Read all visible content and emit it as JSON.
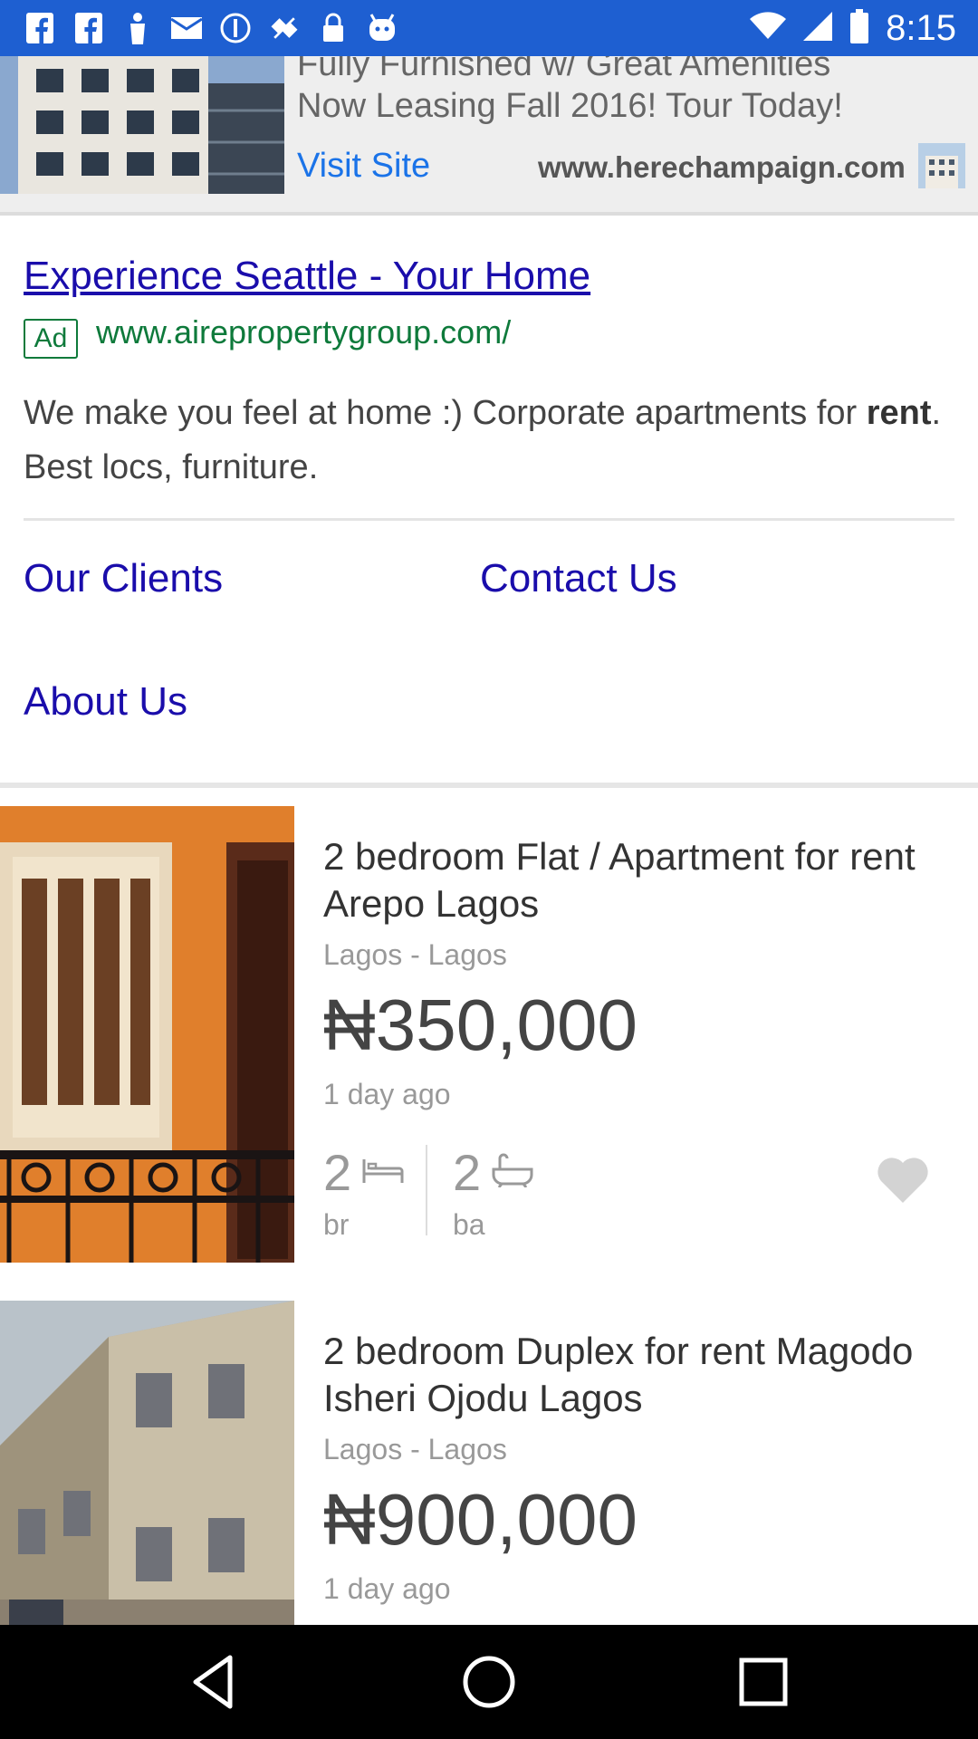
{
  "status_bar": {
    "time": "8:15",
    "icons": [
      "facebook-icon",
      "facebook-icon",
      "person-icon",
      "mail-icon",
      "target-icon",
      "fake-gps-icon",
      "lock-icon",
      "app-icon"
    ],
    "right_icons": [
      "wifi-icon",
      "signal-icon",
      "battery-icon"
    ]
  },
  "banner_ad": {
    "line1": "Fully Furnished w/ Great Amenities",
    "line2": "Now Leasing Fall 2016! Tour Today!",
    "visit_label": "Visit Site",
    "url": "www.herechampaign.com"
  },
  "text_ad": {
    "title": "Experience Seattle - Your Home",
    "badge": "Ad",
    "url": "www.airepropertygroup.com/",
    "description_before": "We make you feel at home :) Corporate apartments for ",
    "description_bold": "rent",
    "description_after": ". Best locs, furniture.",
    "links": [
      "Our Clients",
      "Contact Us",
      "About Us"
    ]
  },
  "listings": [
    {
      "title": "2 bedroom Flat / Apartment for rent Arepo Lagos",
      "location": "Lagos - Lagos",
      "price": "₦350,000",
      "age": "1 day ago",
      "bedrooms": "2",
      "bedrooms_unit": "br",
      "bathrooms": "2",
      "bathrooms_unit": "ba"
    },
    {
      "title": "2 bedroom Duplex for rent Magodo Isheri Ojodu Lagos",
      "location": "Lagos - Lagos",
      "price": "₦900,000",
      "age": "1 day ago"
    }
  ],
  "nav_bar": {
    "buttons": [
      "back-icon",
      "home-icon",
      "recents-icon"
    ]
  },
  "colors": {
    "status_bar": "#1e5fd1",
    "link": "#1a0dab",
    "ad_green": "#0e7a3b",
    "banner_link": "#1a73e8"
  }
}
